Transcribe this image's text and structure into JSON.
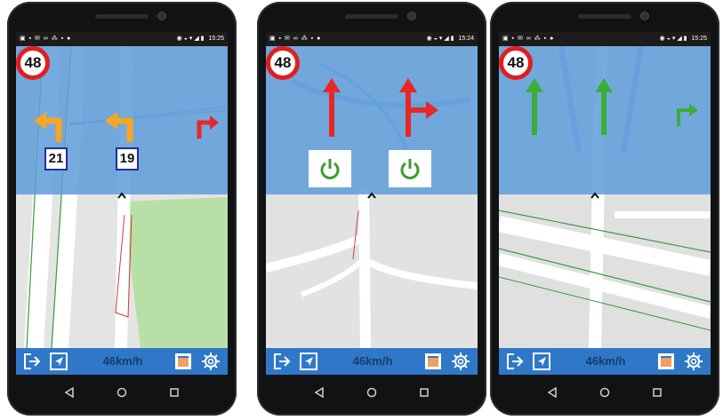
{
  "phones": [
    {
      "status": {
        "icons_left": "▣ ▪ ✉ ∞ ⁂ ▪ ●",
        "icons_right": "◉ ◒ ▾ ◢ ▮",
        "time": "15:25"
      },
      "speed_limit": "48",
      "lane_numbers": [
        "21",
        "19"
      ],
      "speed_text": "46km/h",
      "arrow_colors": {
        "lane": "#f5a623",
        "turn": "#e82727"
      }
    },
    {
      "status": {
        "icons_left": "▣ ▪ ✉ ∞ ⁂ ▪ ●",
        "icons_right": "◉ ◒ ▾ ◢ ▮",
        "time": "15:24"
      },
      "speed_limit": "48",
      "speed_text": "46km/h",
      "arrow_colors": {
        "lane": "#e82727",
        "power": "#3f9b2e"
      }
    },
    {
      "status": {
        "icons_left": "▣ ▪ ✉ ∞ ⁂ ▪ ●",
        "icons_right": "◉ ◒ ▾ ◢ ▮",
        "time": "15:25"
      },
      "speed_limit": "48",
      "speed_text": "46km/h",
      "arrow_colors": {
        "lane": "#3aae36",
        "turn": "#3aae36"
      }
    }
  ],
  "toolbar_icons": [
    "exit-icon",
    "navigate-icon",
    "map-layer-icon",
    "settings-gear-icon"
  ],
  "nav_icons": [
    "back-icon",
    "home-icon",
    "recents-icon"
  ]
}
